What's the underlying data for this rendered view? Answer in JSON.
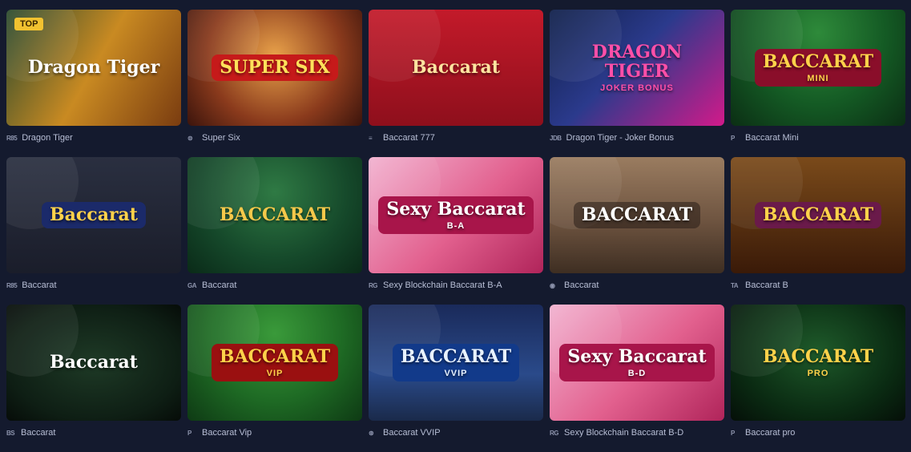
{
  "top_badge": "TOP",
  "games": [
    {
      "id": "dragon-tiger",
      "title_art": "Dragon Tiger",
      "name": "Dragon Tiger",
      "provider": "R85",
      "bg": "linear-gradient(120deg,#2a4a2e 0%,#c98a22 50%,#7a3c10 100%)",
      "text_color": "#ffffff",
      "plate": "transparent"
    },
    {
      "id": "super-six",
      "title_art": "SUPER SIX",
      "name": "Super Six",
      "provider": "⊜",
      "bg": "radial-gradient(circle at 50% 40%,#e9a24a 0%,#8a3a1c 60%,#3b140c 100%)",
      "text_color": "#ffe15a",
      "plate": "#c61a1a"
    },
    {
      "id": "baccarat-777",
      "title_art": "Baccarat",
      "name": "Baccarat 777",
      "provider": "≡",
      "bg": "linear-gradient(180deg,#c31a2a 0%,#8e0f1c 100%)",
      "text_color": "#ffe4a0",
      "plate": "transparent"
    },
    {
      "id": "dragon-tiger-joker",
      "title_art": "DRAGON TIGER",
      "title_sub": "JOKER BONUS",
      "name": "Dragon Tiger - Joker Bonus",
      "provider": "JDB",
      "bg": "linear-gradient(135deg,#10204a 0%,#2b3a8c 45%,#d21a8a 100%)",
      "text_color": "#ff4fa8",
      "plate": "transparent"
    },
    {
      "id": "baccarat-mini",
      "title_art": "BACCARAT",
      "title_sub": "MINI",
      "name": "Baccarat Mini",
      "provider": "P",
      "bg": "radial-gradient(ellipse at 50% 20%,#2e8a3a 0%,#145a24 55%,#0b2e14 100%)",
      "text_color": "#ffd24a",
      "plate": "#8a0e2a"
    },
    {
      "id": "baccarat-r85",
      "title_art": "Baccarat",
      "name": "Baccarat",
      "provider": "R85",
      "bg": "linear-gradient(180deg,#2a2f40 0%,#1a1d2a 100%)",
      "text_color": "#ffd24a",
      "plate": "#1b2a6a"
    },
    {
      "id": "baccarat-ga",
      "title_art": "BACCARAT",
      "name": "Baccarat",
      "provider": "GA",
      "bg": "radial-gradient(ellipse at 50% 30%,#2f7a44 0%,#15482a 60%,#0a2a18 100%)",
      "text_color": "#f5c84a",
      "plate": "transparent"
    },
    {
      "id": "sexy-baccarat-ba",
      "title_art": "Sexy Baccarat",
      "title_sub": "B-A",
      "name": "Sexy Blockchain Baccarat B-A",
      "provider": "RG",
      "bg": "linear-gradient(135deg,#f2b2d0 0%,#e2608e 55%,#b0245a 100%)",
      "text_color": "#ffffff",
      "plate": "#a8154a"
    },
    {
      "id": "baccarat-pin",
      "title_art": "BACCARAT",
      "name": "Baccarat",
      "provider": "◉",
      "bg": "linear-gradient(180deg,#9a7c60 0%,#6e5440 55%,#3e2e22 100%)",
      "text_color": "#ffffff",
      "plate": "rgba(40,30,24,0.55)"
    },
    {
      "id": "baccarat-b",
      "title_art": "BACCARAT",
      "name": "Baccarat B",
      "provider": "TA",
      "bg": "linear-gradient(180deg,#7a4a1a 0%,#3a1a08 100%)",
      "text_color": "#ffd24a",
      "plate": "#6a1a4a"
    },
    {
      "id": "baccarat-bs",
      "title_art": "Baccarat",
      "name": "Baccarat",
      "provider": "BS",
      "bg": "radial-gradient(ellipse at 50% 50%,#1e3a26 0%,#0e1e14 70%,#060c08 100%)",
      "text_color": "#ffffff",
      "plate": "transparent"
    },
    {
      "id": "baccarat-vip",
      "title_art": "BACCARAT",
      "title_sub": "VIP",
      "name": "Baccarat Vip",
      "provider": "P",
      "bg": "radial-gradient(ellipse at 50% 25%,#3a9a3a 0%,#1e6a24 55%,#0e3a14 100%)",
      "text_color": "#ffd24a",
      "plate": "#9a1010"
    },
    {
      "id": "baccarat-vvip",
      "title_art": "BACCARAT",
      "title_sub": "VVIP",
      "name": "Baccarat VVIP",
      "provider": "⊛",
      "bg": "linear-gradient(180deg,#1a2a5a 0%,#2a4a8a 60%,#1a2a4a 100%)",
      "text_color": "#e8f2ff",
      "plate": "#123a8a"
    },
    {
      "id": "sexy-baccarat-bd",
      "title_art": "Sexy Baccarat",
      "title_sub": "B-D",
      "name": "Sexy Blockchain Baccarat B-D",
      "provider": "RG",
      "bg": "linear-gradient(135deg,#f2b2d0 0%,#e2608e 55%,#b0245a 100%)",
      "text_color": "#ffffff",
      "plate": "#a8154a"
    },
    {
      "id": "baccarat-pro",
      "title_art": "BACCARAT",
      "title_sub": "PRO",
      "name": "Baccarat pro",
      "provider": "P",
      "bg": "radial-gradient(ellipse at 50% 40%,#1e5a2a 0%,#0a2a12 65%,#050f08 100%)",
      "text_color": "#ffd24a",
      "plate": "transparent"
    }
  ]
}
